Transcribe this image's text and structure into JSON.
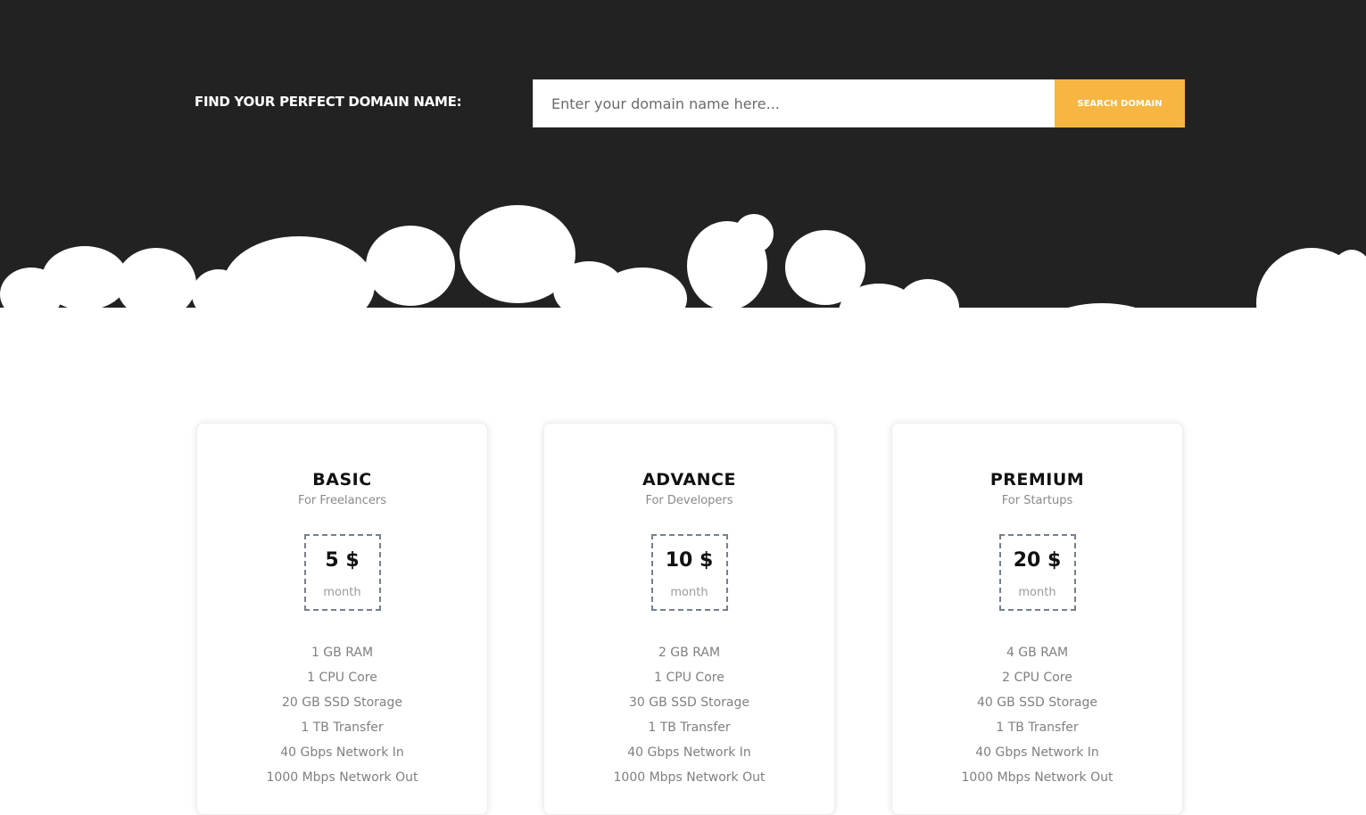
{
  "domain_search": {
    "label": "FIND YOUR PERFECT DOMAIN NAME:",
    "placeholder": "Enter your domain name here...",
    "button_label": "SEARCH DOMAIN",
    "accent_color": "#f7b641",
    "background_color": "#222222"
  },
  "plans": [
    {
      "name": "BASIC",
      "subtitle": "For Freelancers",
      "price": "5 $",
      "period": "month",
      "features": [
        "1 GB RAM",
        "1 CPU Core",
        "20 GB SSD Storage",
        "1 TB Transfer",
        "40 Gbps Network In",
        "1000 Mbps Network Out"
      ]
    },
    {
      "name": "ADVANCE",
      "subtitle": "For Developers",
      "price": "10 $",
      "period": "month",
      "features": [
        "2 GB RAM",
        "1 CPU Core",
        "30 GB SSD Storage",
        "1 TB Transfer",
        "40 Gbps Network In",
        "1000 Mbps Network Out"
      ]
    },
    {
      "name": "PREMIUM",
      "subtitle": "For Startups",
      "price": "20 $",
      "period": "month",
      "features": [
        "4 GB RAM",
        "2 CPU Core",
        "40 GB SSD Storage",
        "1 TB Transfer",
        "40 Gbps Network In",
        "1000 Mbps Network Out"
      ]
    }
  ]
}
